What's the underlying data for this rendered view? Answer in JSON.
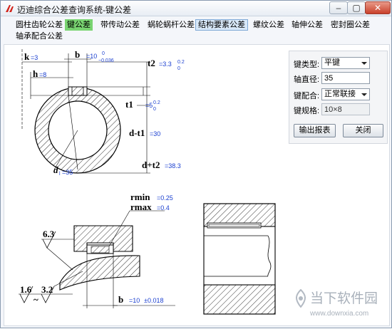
{
  "window": {
    "title": "迈迪综合公差查询系统-键公差"
  },
  "tabs": [
    {
      "label": "圆柱齿轮公差"
    },
    {
      "label": "键公差"
    },
    {
      "label": "带传动公差"
    },
    {
      "label": "蜗轮蜗杆公差"
    },
    {
      "label": "结构要素公差"
    },
    {
      "label": "螺纹公差"
    },
    {
      "label": "轴伸公差"
    },
    {
      "label": "密封圈公差"
    },
    {
      "label": "轴承配合公差"
    }
  ],
  "colors": {
    "active_tab": "#79d471",
    "selected_tab": "#d8e8f8",
    "value_text": "#1a3fd0"
  },
  "drawing": {
    "k_label": "k",
    "k_value": "=3",
    "h_label": "h",
    "h_value": "=8",
    "b_label": "b",
    "b_value": "=10",
    "b_tol_upper": "0",
    "b_tol_lower": "−0.036",
    "t2_label": "t2",
    "t2_value": "=3.3",
    "t2_tol_upper": "0.2",
    "t2_tol_lower": "0",
    "t1_label": "t1",
    "t1_value": "=5",
    "t1_tol_upper": "0.2",
    "t1_tol_lower": "0",
    "dt1_label": "d-t1",
    "dt1_value": "=30",
    "dt2_label": "d+t2",
    "dt2_value": "=38.3",
    "d_label": "d",
    "d_sub": "l",
    "d_value": "=35",
    "rmin_label": "rmin",
    "rmin_value": "=0.25",
    "rmax_label": "rmax",
    "rmax_value": "=0.4",
    "rough_63": "6.3",
    "rough_16": "1.6",
    "rough_32": "3.2",
    "tilde": "~",
    "b2_label": "b",
    "b2_value": "=10",
    "b2_tol": "±0.018"
  },
  "panel": {
    "key_type_label": "键类型:",
    "key_type_value": "平键",
    "shaft_dia_label": "轴直径:",
    "shaft_dia_value": "35",
    "fit_label": "键配合:",
    "fit_value": "正常联接",
    "spec_label": "键规格:",
    "spec_value": "10×8",
    "export_button": "输出报表",
    "close_button": "关闭"
  },
  "watermark": {
    "text": "当下软件园",
    "url": "www.downxia.com"
  }
}
